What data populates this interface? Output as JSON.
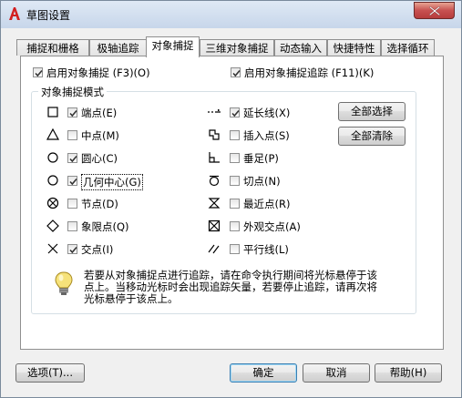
{
  "window": {
    "title": "草图设置",
    "app_icon": "autocad-a-icon",
    "close_icon": "close-icon"
  },
  "tabs": [
    {
      "label": "捕捉和栅格"
    },
    {
      "label": "极轴追踪"
    },
    {
      "label": "对象捕捉",
      "active": true
    },
    {
      "label": "三维对象捕捉"
    },
    {
      "label": "动态输入"
    },
    {
      "label": "快捷特性"
    },
    {
      "label": "选择循环"
    }
  ],
  "osnap": {
    "enable_label": "启用对象捕捉 (F3)(O)",
    "enable_checked": true,
    "tracking_label": "启用对象捕捉追踪 (F11)(K)",
    "tracking_checked": true
  },
  "modes": {
    "group_title": "对象捕捉模式",
    "left": [
      {
        "label": "端点(E)",
        "checked": true,
        "symbol": "square-endpoint-icon"
      },
      {
        "label": "中点(M)",
        "checked": false,
        "symbol": "triangle-midpoint-icon"
      },
      {
        "label": "圆心(C)",
        "checked": true,
        "symbol": "circle-center-icon"
      },
      {
        "label": "几何中心(G)",
        "checked": true,
        "symbol": "circle-geometric-center-icon"
      },
      {
        "label": "节点(D)",
        "checked": false,
        "symbol": "node-icon"
      },
      {
        "label": "象限点(Q)",
        "checked": false,
        "symbol": "diamond-quadrant-icon"
      },
      {
        "label": "交点(I)",
        "checked": true,
        "symbol": "x-intersection-icon"
      }
    ],
    "right": [
      {
        "label": "延长线(X)",
        "checked": true,
        "symbol": "extension-icon"
      },
      {
        "label": "插入点(S)",
        "checked": false,
        "symbol": "insertion-icon"
      },
      {
        "label": "垂足(P)",
        "checked": false,
        "symbol": "perpendicular-icon"
      },
      {
        "label": "切点(N)",
        "checked": false,
        "symbol": "tangent-icon"
      },
      {
        "label": "最近点(R)",
        "checked": false,
        "symbol": "nearest-icon"
      },
      {
        "label": "外观交点(A)",
        "checked": false,
        "symbol": "apparent-intersection-icon"
      },
      {
        "label": "平行线(L)",
        "checked": false,
        "symbol": "parallel-icon"
      }
    ],
    "select_all": "全部选择",
    "clear_all": "全部清除"
  },
  "info": {
    "icon": "lightbulb-icon",
    "text": "若要从对象捕捉点进行追踪，请在命令执行期间将光标悬停于该点上。当移动光标时会出现追踪矢量，若要停止追踪，请再次将光标悬停于该点上。"
  },
  "footer": {
    "options": "选项(T)...",
    "ok": "确定",
    "cancel": "取消",
    "help": "帮助(H)"
  }
}
